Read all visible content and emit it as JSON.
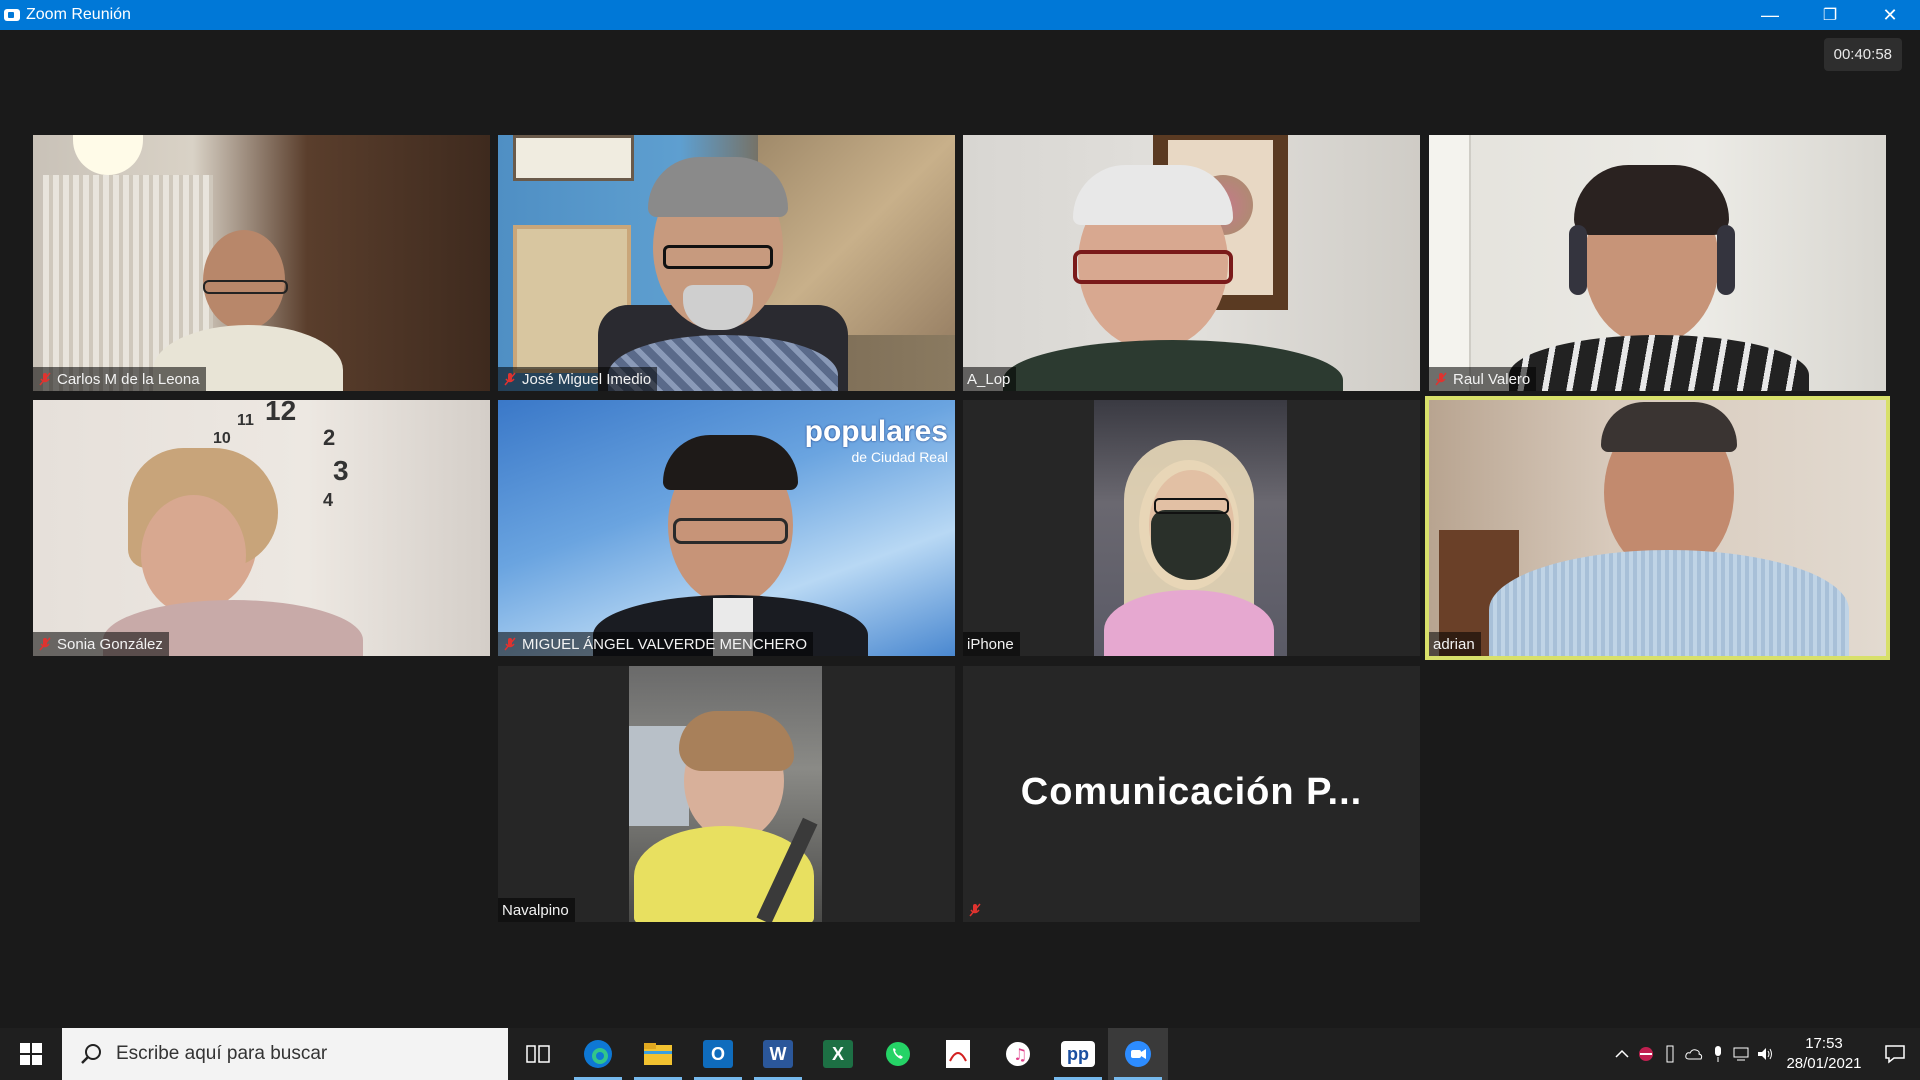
{
  "window": {
    "title": "Zoom Reunión",
    "minimize": "—",
    "maximize": "❐",
    "close": "✕"
  },
  "meeting": {
    "timer": "00:40:58"
  },
  "participants": [
    {
      "name": "Carlos M de la Leona",
      "muted": true
    },
    {
      "name": "José Miguel Imedio",
      "muted": true
    },
    {
      "name": "A_Lop",
      "muted": false
    },
    {
      "name": "Raul Valero",
      "muted": true
    },
    {
      "name": "Sonia González",
      "muted": true
    },
    {
      "name": "MIGUEL ÁNGEL VALVERDE MENCHERO",
      "muted": true,
      "background_brand": "populares",
      "background_sub": "de Ciudad Real"
    },
    {
      "name": "iPhone",
      "muted": false
    },
    {
      "name": "adrian",
      "muted": false,
      "active_speaker": true
    },
    {
      "name": "Navalpino",
      "muted": false
    },
    {
      "name": "Comunicación  P...",
      "muted": true,
      "video_off": true
    }
  ],
  "taskbar": {
    "search_placeholder": "Escribe aquí para buscar",
    "apps": [
      "task-view",
      "edge",
      "file-explorer",
      "outlook",
      "word",
      "excel",
      "whatsapp",
      "acrobat",
      "itunes",
      "pp",
      "zoom"
    ],
    "app_labels": {
      "outlook": "O",
      "word": "W",
      "excel": "X",
      "pp": "pp"
    },
    "time": "17:53",
    "date": "28/01/2021"
  },
  "colors": {
    "titlebar": "#0078d7",
    "speaker_border": "#d8e06a",
    "muted_red": "#e0332f"
  }
}
